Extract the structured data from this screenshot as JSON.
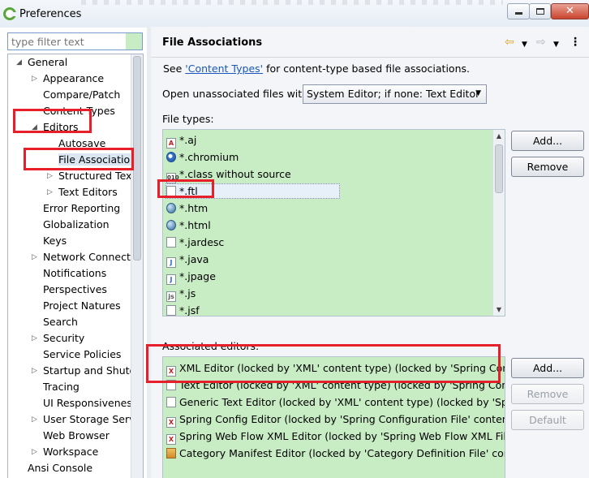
{
  "window": {
    "title": "Preferences"
  },
  "filter": {
    "placeholder": "type filter text"
  },
  "tree": [
    {
      "label": "General",
      "arrow": "◢",
      "expanded": true
    },
    {
      "label": "Appearance",
      "arrow": "▷"
    },
    {
      "label": "Compare/Patch",
      "arrow": ""
    },
    {
      "label": "Content Types",
      "arrow": ""
    },
    {
      "label": "Editors",
      "arrow": "◢",
      "expanded": true
    },
    {
      "label": "Autosave",
      "arrow": ""
    },
    {
      "label": "File Associations",
      "arrow": "",
      "selected": true
    },
    {
      "label": "Structured Text Editors",
      "arrow": "▷"
    },
    {
      "label": "Text Editors",
      "arrow": "▷"
    },
    {
      "label": "Error Reporting",
      "arrow": ""
    },
    {
      "label": "Globalization",
      "arrow": ""
    },
    {
      "label": "Keys",
      "arrow": ""
    },
    {
      "label": "Network Connections",
      "arrow": "▷"
    },
    {
      "label": "Notifications",
      "arrow": ""
    },
    {
      "label": "Perspectives",
      "arrow": ""
    },
    {
      "label": "Project Natures",
      "arrow": ""
    },
    {
      "label": "Search",
      "arrow": ""
    },
    {
      "label": "Security",
      "arrow": "▷"
    },
    {
      "label": "Service Policies",
      "arrow": ""
    },
    {
      "label": "Startup and Shutdown",
      "arrow": "▷"
    },
    {
      "label": "Tracing",
      "arrow": ""
    },
    {
      "label": "UI Responsiveness",
      "arrow": ""
    },
    {
      "label": "User Storage Service",
      "arrow": "▷"
    },
    {
      "label": "Web Browser",
      "arrow": ""
    },
    {
      "label": "Workspace",
      "arrow": "▷"
    },
    {
      "label": "Ansi Console",
      "arrow": ""
    }
  ],
  "page": {
    "title": "File Associations",
    "info_prefix": "See ",
    "info_link": "'Content Types'",
    "info_suffix": " for content-type based file associations.",
    "open_label": "Open unassociated files with:",
    "open_value": "System Editor; if none: Text Editor",
    "file_types_label": "File types:",
    "assoc_label": "Associated editors:"
  },
  "file_types": [
    {
      "label": "*.aj",
      "icon": "aj-file-icon"
    },
    {
      "label": "*.chromium",
      "icon": "chromium-icon"
    },
    {
      "label": "*.class without source",
      "icon": "class-file-icon"
    },
    {
      "label": "*.ftl",
      "icon": "text-file-icon",
      "selected": true
    },
    {
      "label": "*.htm",
      "icon": "web-browser-icon"
    },
    {
      "label": "*.html",
      "icon": "web-browser-icon"
    },
    {
      "label": "*.jardesc",
      "icon": "jardesc-icon"
    },
    {
      "label": "*.java",
      "icon": "java-file-icon"
    },
    {
      "label": "*.jpage",
      "icon": "jpage-icon"
    },
    {
      "label": "*.js",
      "icon": "js-file-icon"
    },
    {
      "label": "*.jsf",
      "icon": "jsf-file-icon"
    }
  ],
  "editors": [
    {
      "label": "XML Editor (locked by 'XML' content type) (locked by 'Spring Config",
      "icon": "xml-editor-icon"
    },
    {
      "label": "Text Editor (locked by 'XML' content type) (locked by 'Spring Config",
      "icon": "text-editor-icon"
    },
    {
      "label": "Generic Text Editor (locked by 'XML' content type) (locked by 'Spring",
      "icon": "generic-editor-icon"
    },
    {
      "label": "Spring Config Editor (locked by 'Spring Configuration File' content ty",
      "icon": "spring-xml-icon"
    },
    {
      "label": "Spring Web Flow XML Editor (locked by 'Spring Web Flow XML File'",
      "icon": "spring-xml-icon"
    },
    {
      "label": "Category Manifest Editor (locked by 'Category Definition File' conten",
      "icon": "manifest-icon"
    }
  ],
  "buttons": {
    "ft_add": "Add...",
    "ft_remove": "Remove",
    "ae_add": "Add...",
    "ae_remove": "Remove",
    "ae_default": "Default"
  },
  "colors": {
    "highlight_red": "#e5202a",
    "list_bg": "#c8ecc4",
    "link": "#1a57b8"
  }
}
